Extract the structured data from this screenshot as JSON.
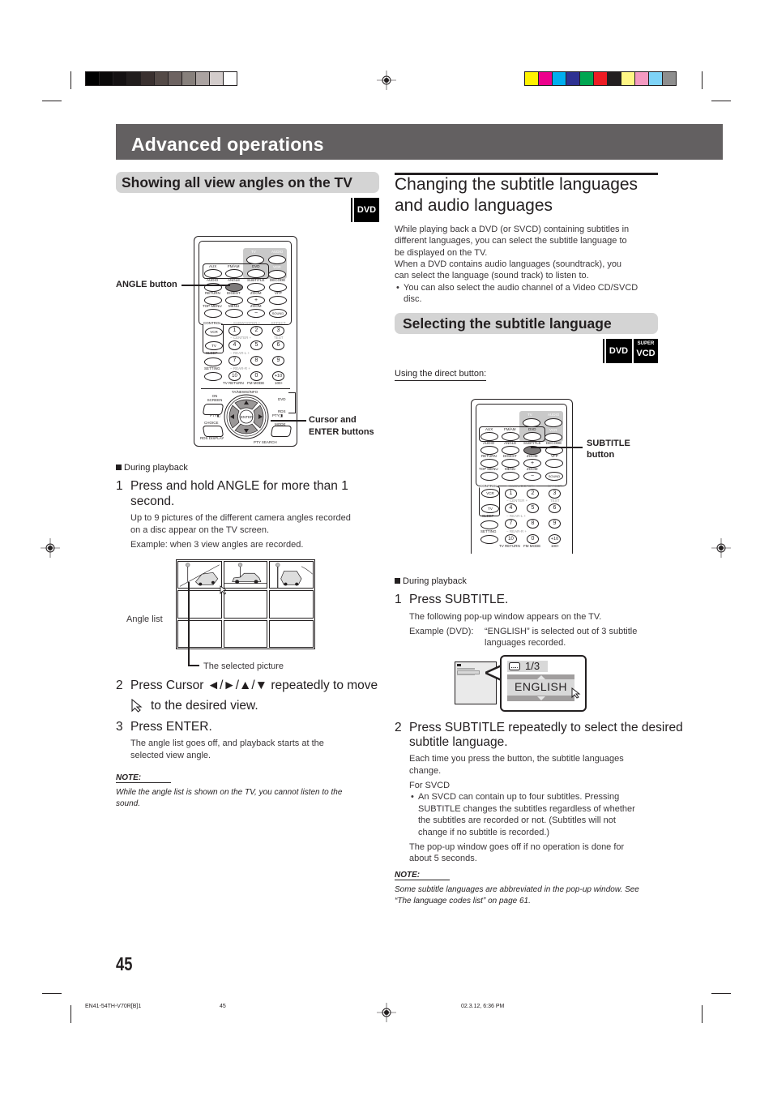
{
  "print_marks": {
    "grayscale_bar": [
      "#000000",
      "#0a0909",
      "#141112",
      "#211d1d",
      "#3a3130",
      "#544a47",
      "#6d6361",
      "#87807c",
      "#aba3a1",
      "#d3cccb",
      "#ffffff"
    ],
    "color_bar": [
      "#fff200",
      "#ec008c",
      "#00aeef",
      "#2e3192",
      "#00a651",
      "#ed1c24",
      "#231f20",
      "#fff685",
      "#f49ac1",
      "#7ed3f7",
      "#8e8e8e"
    ]
  },
  "header": {
    "title": "Advanced operations"
  },
  "left": {
    "section_title": "Showing all view angles on the TV",
    "badge": "DVD",
    "remote_callouts": {
      "angle": "ANGLE button",
      "cursor_line1": "Cursor and",
      "cursor_line2": "ENTER buttons"
    },
    "remote": {
      "power_labels": {
        "tv": "TV",
        "audio": "AUDIO",
        "vcr": "VCR",
        "symbol": "⏻/I"
      },
      "row1": [
        "AUX",
        "FM/AM",
        "DVD"
      ],
      "row2": [
        "AUDIO",
        "ANGLE",
        "SUBTITLE",
        "DECODE"
      ],
      "row3": [
        "RETURN",
        "DIGEST",
        "ZOOM",
        "VFP"
      ],
      "row4": [
        "TOP MENU",
        "MENU",
        "ZOOM"
      ],
      "zoom_plus": "+",
      "zoom_minus": "−",
      "sound": "SOUND",
      "control": "CONTROL",
      "vcr": "VCR",
      "tv": "TV",
      "sleep": "SLEEP",
      "setting": "SETTING",
      "sub_labels": [
        "−  SUBWOOFER  +",
        "EFFECT",
        "−  CENTER  +",
        "TEST",
        "−  REAR-L  +",
        "−  REAR-R  +"
      ],
      "numbers": [
        "1",
        "2",
        "3",
        "4",
        "5",
        "6",
        "7",
        "8",
        "9",
        "10",
        "0",
        "+10"
      ],
      "bottom_labels": [
        "TV RETURN",
        "FM MODE",
        "100+"
      ],
      "nav": {
        "top": "TA/NEWS/INFO",
        "on_screen": "ON SCREEN",
        "choice": "CHOICE",
        "rds_display": "RDS DISPLAY",
        "mode": "MODE",
        "pty_search": "PTY SEARCH",
        "enter": "ENTER",
        "pty_left": "PTY◧",
        "pty_right": "PTY◨",
        "dvd_switch": "DVD",
        "rds_switch": "RDS"
      }
    },
    "during_playback": "During playback",
    "step1": {
      "num": "1",
      "line1": "Press and hold ANGLE for more than 1",
      "line2": "second.",
      "desc1": "Up to 9 pictures of the different camera angles recorded",
      "desc2": "on a disc appear on the TV screen.",
      "example": "Example: when 3 view angles are recorded."
    },
    "angle_list_label": "Angle list",
    "selected_picture_label": "The selected picture",
    "step2": {
      "num": "2",
      "line1": "Press Cursor ◄/►/▲/▼ repeatedly to move",
      "line2": "to the desired view."
    },
    "step3": {
      "num": "3",
      "line1": "Press ENTER.",
      "desc1": "The angle list goes off, and playback starts at the",
      "desc2": "selected view angle."
    },
    "note": {
      "label": "NOTE:",
      "line1": "While the angle list is shown on the TV, you cannot listen to the",
      "line2": "sound."
    }
  },
  "right": {
    "title_line1": "Changing the subtitle languages",
    "title_line2": "and audio languages",
    "intro": [
      "While playing back a DVD (or SVCD) containing subtitles in",
      "different languages, you can select the subtitle language to",
      "be displayed on the TV.",
      "When a DVD contains audio languages (soundtrack), you",
      "can select the language (sound track) to listen to."
    ],
    "bullet1": [
      "You can also select the audio channel of a Video CD/SVCD",
      "disc."
    ],
    "subsection_title": "Selecting the subtitle language",
    "badge_dvd": "DVD",
    "badge_super": "SUPER",
    "badge_vcd": "VCD",
    "direct_button": "Using the direct button:",
    "subtitle_callout1": "SUBTITLE",
    "subtitle_callout2": "button",
    "during_playback": "During playback",
    "step1": {
      "num": "1",
      "line1": "Press SUBTITLE.",
      "desc1": "The following pop-up window appears on the TV.",
      "example_label": "Example (DVD):",
      "example1": "“ENGLISH” is selected out of 3 subtitle",
      "example2": "languages recorded."
    },
    "popup": {
      "count": "1/3",
      "language": "ENGLISH"
    },
    "step2": {
      "num": "2",
      "line1": "Press SUBTITLE repeatedly to select the desired",
      "line2": "subtitle language.",
      "desc": [
        "Each time you press the button, the subtitle languages",
        "change."
      ],
      "for_svcd": "For SVCD",
      "svcd_bullet": [
        "An SVCD can contain up to four subtitles. Pressing",
        "SUBTITLE changes the subtitles regardless of whether",
        "the subtitles are recorded or not. (Subtitles will not",
        "change if no subtitle is recorded.)"
      ],
      "popup_off": [
        "The pop-up window goes off if no operation is done for",
        "about 5 seconds."
      ]
    },
    "note": {
      "label": "NOTE:",
      "line1": "Some subtitle languages are abbreviated in the pop-up window. See",
      "line2": "“The language codes list” on page 61."
    }
  },
  "footer": {
    "page_number": "45",
    "file_code": "EN41-54TH-V70R[B]1",
    "file_page": "45",
    "timestamp": "02.3.12, 6:36 PM"
  }
}
